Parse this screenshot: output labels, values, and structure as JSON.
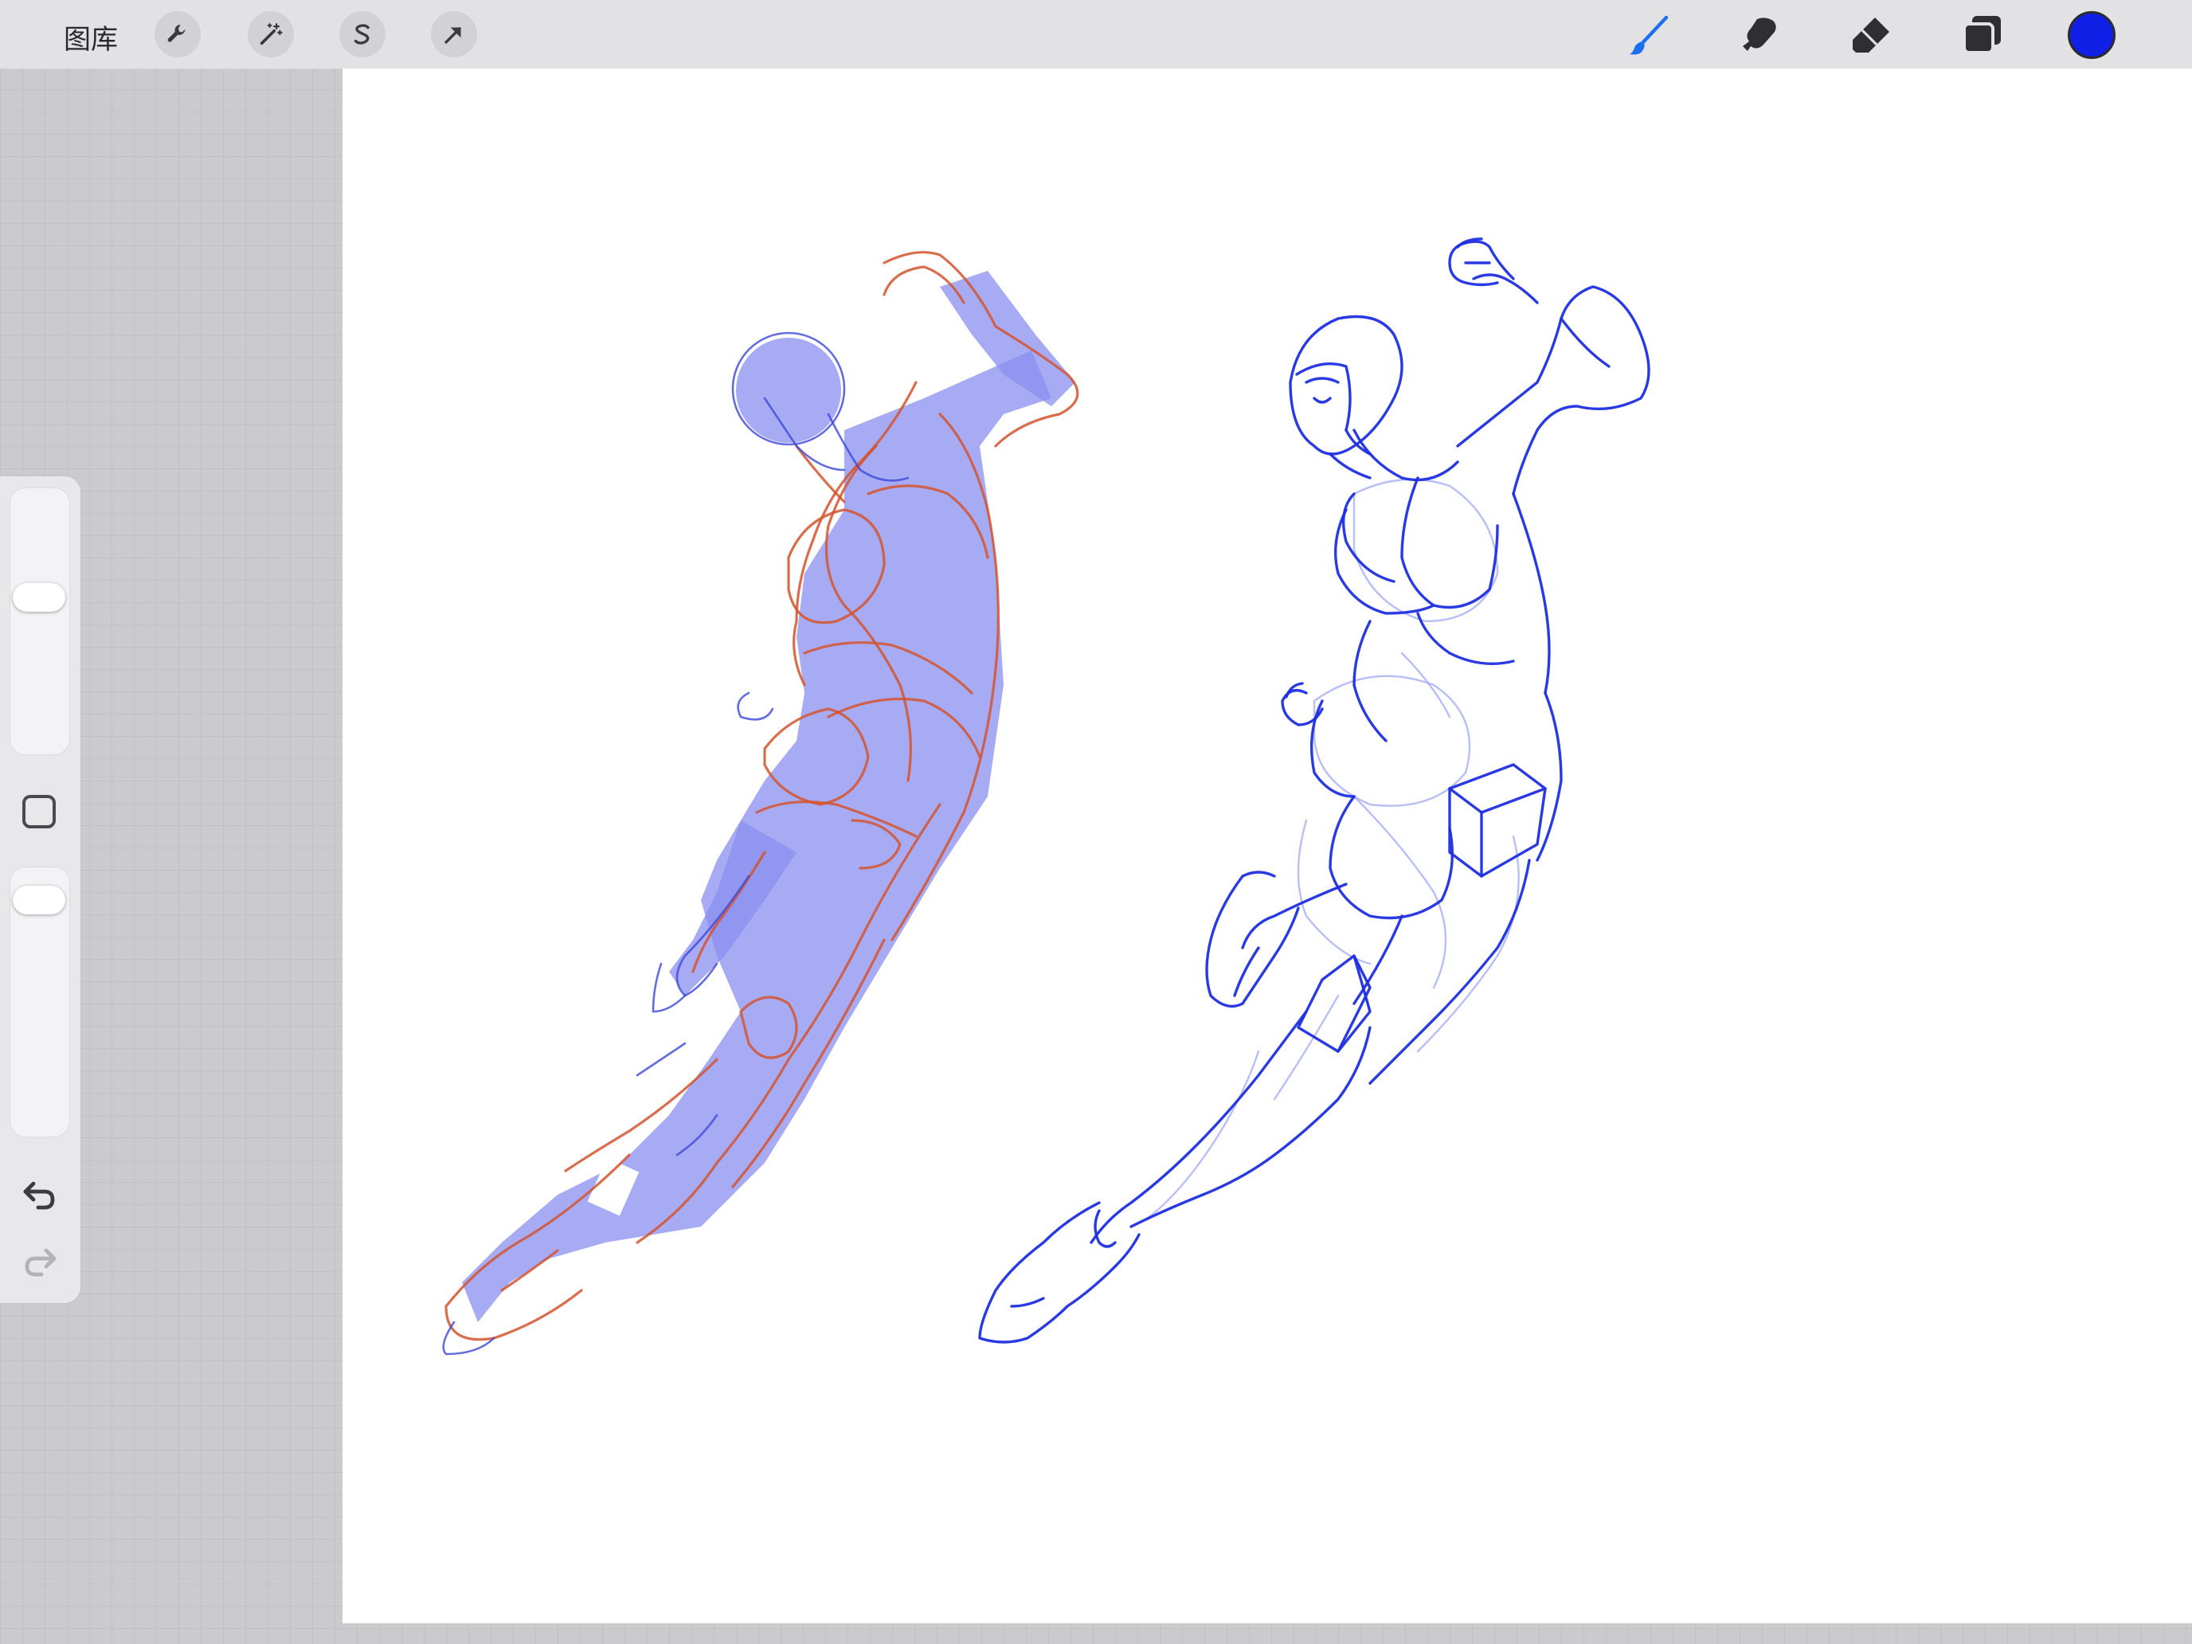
{
  "toolbar": {
    "gallery_label": "图库",
    "left_tools": [
      {
        "name": "actions",
        "icon": "wrench-icon"
      },
      {
        "name": "adjustments",
        "icon": "magic-wand-icon"
      },
      {
        "name": "selection",
        "icon": "selection-s-icon"
      },
      {
        "name": "transform",
        "icon": "arrow-cursor-icon"
      }
    ],
    "right_tools": [
      {
        "name": "brush",
        "icon": "brush-icon",
        "active": true
      },
      {
        "name": "smudge",
        "icon": "smudge-icon"
      },
      {
        "name": "eraser",
        "icon": "eraser-icon"
      },
      {
        "name": "layers",
        "icon": "layers-icon"
      }
    ],
    "current_color": "#1020e6"
  },
  "sidebar": {
    "brush_size_level": 0.6,
    "opacity_level": 0.92,
    "modify_icon": "square-icon",
    "undo_icon": "undo-icon",
    "redo_icon": "redo-icon"
  },
  "colors": {
    "sketch_blue": "#1f2fe0",
    "sketch_red": "#d4532e",
    "sketch_fill": "#8a8ff0",
    "accent": "#1d6ff2"
  }
}
